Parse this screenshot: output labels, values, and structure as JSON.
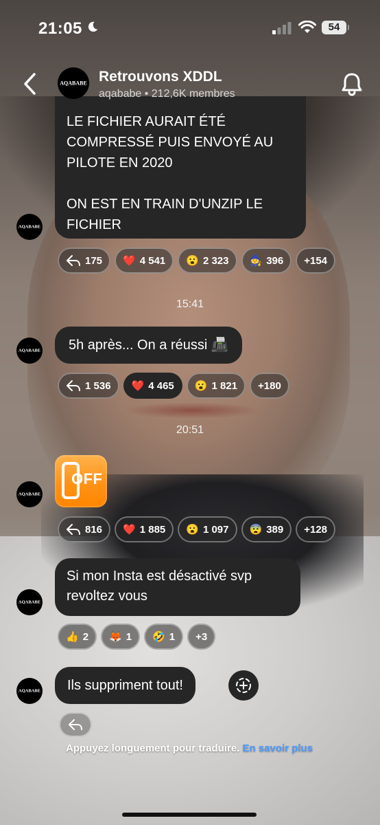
{
  "status_bar": {
    "time": "21:05",
    "battery": "54"
  },
  "header": {
    "group_name": "Retrouvons XDDL",
    "avatar_text": "AQABABE",
    "subtitle": "aqababe • 212,6K membres"
  },
  "messages": [
    {
      "text": "LE FICHIER AURAIT ÉTÉ\nCOMPRESSÉ PUIS ENVOYÉ AU\nPILOTE EN 2020\n\nON EST EN TRAIN D'UNZIP LE\nFICHIER",
      "avatar_text": "AQABABE",
      "reactions": [
        {
          "emoji": "",
          "count": "175",
          "type": "reply"
        },
        {
          "emoji": "❤️",
          "count": "4 541"
        },
        {
          "emoji": "😮",
          "count": "2 323"
        },
        {
          "emoji": "🧙",
          "count": "396"
        },
        {
          "emoji": "",
          "count": "+154"
        }
      ]
    },
    {
      "timestamp": "15:41",
      "text": "5h après... On a réussi 📠",
      "avatar_text": "AQABABE",
      "reactions": [
        {
          "emoji": "",
          "count": "1 536",
          "type": "reply"
        },
        {
          "emoji": "❤️",
          "count": "4 465"
        },
        {
          "emoji": "😮",
          "count": "1 821"
        },
        {
          "emoji": "",
          "count": "+180"
        }
      ]
    },
    {
      "timestamp": "20:51",
      "sticker_text": "OFF",
      "avatar_text": "AQABABE",
      "reactions": [
        {
          "emoji": "",
          "count": "816",
          "type": "reply"
        },
        {
          "emoji": "❤️",
          "count": "1 885"
        },
        {
          "emoji": "😮",
          "count": "1 097"
        },
        {
          "emoji": "😨",
          "count": "389"
        },
        {
          "emoji": "",
          "count": "+128"
        }
      ]
    },
    {
      "text": "Si mon Insta est désactivé svp revoltez vous",
      "avatar_text": "AQABABE",
      "reactions": [
        {
          "emoji": "👍",
          "count": "2"
        },
        {
          "emoji": "🦊",
          "count": "1"
        },
        {
          "emoji": "🤣",
          "count": "1"
        },
        {
          "emoji": "",
          "count": "+3"
        }
      ]
    },
    {
      "text": "Ils suppriment tout!",
      "avatar_text": "AQABABE"
    }
  ],
  "footer": {
    "translate_hint": "Appuyez longuement pour traduire.",
    "learn_more": "En savoir plus"
  },
  "icons": [
    "moon-icon",
    "signal-icon",
    "wifi-icon",
    "back-chevron-icon",
    "bell-icon",
    "reply-icon",
    "add-reaction-icon"
  ]
}
